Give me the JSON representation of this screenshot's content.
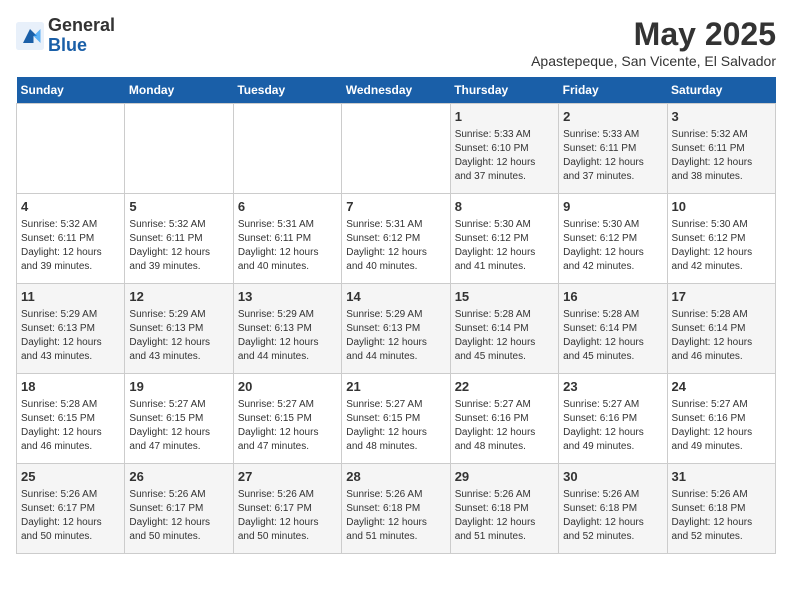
{
  "header": {
    "logo_general": "General",
    "logo_blue": "Blue",
    "month_year": "May 2025",
    "location": "Apastepeque, San Vicente, El Salvador"
  },
  "weekdays": [
    "Sunday",
    "Monday",
    "Tuesday",
    "Wednesday",
    "Thursday",
    "Friday",
    "Saturday"
  ],
  "weeks": [
    [
      {
        "day": "",
        "info": ""
      },
      {
        "day": "",
        "info": ""
      },
      {
        "day": "",
        "info": ""
      },
      {
        "day": "",
        "info": ""
      },
      {
        "day": "1",
        "info": "Sunrise: 5:33 AM\nSunset: 6:10 PM\nDaylight: 12 hours\nand 37 minutes."
      },
      {
        "day": "2",
        "info": "Sunrise: 5:33 AM\nSunset: 6:11 PM\nDaylight: 12 hours\nand 37 minutes."
      },
      {
        "day": "3",
        "info": "Sunrise: 5:32 AM\nSunset: 6:11 PM\nDaylight: 12 hours\nand 38 minutes."
      }
    ],
    [
      {
        "day": "4",
        "info": "Sunrise: 5:32 AM\nSunset: 6:11 PM\nDaylight: 12 hours\nand 39 minutes."
      },
      {
        "day": "5",
        "info": "Sunrise: 5:32 AM\nSunset: 6:11 PM\nDaylight: 12 hours\nand 39 minutes."
      },
      {
        "day": "6",
        "info": "Sunrise: 5:31 AM\nSunset: 6:11 PM\nDaylight: 12 hours\nand 40 minutes."
      },
      {
        "day": "7",
        "info": "Sunrise: 5:31 AM\nSunset: 6:12 PM\nDaylight: 12 hours\nand 40 minutes."
      },
      {
        "day": "8",
        "info": "Sunrise: 5:30 AM\nSunset: 6:12 PM\nDaylight: 12 hours\nand 41 minutes."
      },
      {
        "day": "9",
        "info": "Sunrise: 5:30 AM\nSunset: 6:12 PM\nDaylight: 12 hours\nand 42 minutes."
      },
      {
        "day": "10",
        "info": "Sunrise: 5:30 AM\nSunset: 6:12 PM\nDaylight: 12 hours\nand 42 minutes."
      }
    ],
    [
      {
        "day": "11",
        "info": "Sunrise: 5:29 AM\nSunset: 6:13 PM\nDaylight: 12 hours\nand 43 minutes."
      },
      {
        "day": "12",
        "info": "Sunrise: 5:29 AM\nSunset: 6:13 PM\nDaylight: 12 hours\nand 43 minutes."
      },
      {
        "day": "13",
        "info": "Sunrise: 5:29 AM\nSunset: 6:13 PM\nDaylight: 12 hours\nand 44 minutes."
      },
      {
        "day": "14",
        "info": "Sunrise: 5:29 AM\nSunset: 6:13 PM\nDaylight: 12 hours\nand 44 minutes."
      },
      {
        "day": "15",
        "info": "Sunrise: 5:28 AM\nSunset: 6:14 PM\nDaylight: 12 hours\nand 45 minutes."
      },
      {
        "day": "16",
        "info": "Sunrise: 5:28 AM\nSunset: 6:14 PM\nDaylight: 12 hours\nand 45 minutes."
      },
      {
        "day": "17",
        "info": "Sunrise: 5:28 AM\nSunset: 6:14 PM\nDaylight: 12 hours\nand 46 minutes."
      }
    ],
    [
      {
        "day": "18",
        "info": "Sunrise: 5:28 AM\nSunset: 6:15 PM\nDaylight: 12 hours\nand 46 minutes."
      },
      {
        "day": "19",
        "info": "Sunrise: 5:27 AM\nSunset: 6:15 PM\nDaylight: 12 hours\nand 47 minutes."
      },
      {
        "day": "20",
        "info": "Sunrise: 5:27 AM\nSunset: 6:15 PM\nDaylight: 12 hours\nand 47 minutes."
      },
      {
        "day": "21",
        "info": "Sunrise: 5:27 AM\nSunset: 6:15 PM\nDaylight: 12 hours\nand 48 minutes."
      },
      {
        "day": "22",
        "info": "Sunrise: 5:27 AM\nSunset: 6:16 PM\nDaylight: 12 hours\nand 48 minutes."
      },
      {
        "day": "23",
        "info": "Sunrise: 5:27 AM\nSunset: 6:16 PM\nDaylight: 12 hours\nand 49 minutes."
      },
      {
        "day": "24",
        "info": "Sunrise: 5:27 AM\nSunset: 6:16 PM\nDaylight: 12 hours\nand 49 minutes."
      }
    ],
    [
      {
        "day": "25",
        "info": "Sunrise: 5:26 AM\nSunset: 6:17 PM\nDaylight: 12 hours\nand 50 minutes."
      },
      {
        "day": "26",
        "info": "Sunrise: 5:26 AM\nSunset: 6:17 PM\nDaylight: 12 hours\nand 50 minutes."
      },
      {
        "day": "27",
        "info": "Sunrise: 5:26 AM\nSunset: 6:17 PM\nDaylight: 12 hours\nand 50 minutes."
      },
      {
        "day": "28",
        "info": "Sunrise: 5:26 AM\nSunset: 6:18 PM\nDaylight: 12 hours\nand 51 minutes."
      },
      {
        "day": "29",
        "info": "Sunrise: 5:26 AM\nSunset: 6:18 PM\nDaylight: 12 hours\nand 51 minutes."
      },
      {
        "day": "30",
        "info": "Sunrise: 5:26 AM\nSunset: 6:18 PM\nDaylight: 12 hours\nand 52 minutes."
      },
      {
        "day": "31",
        "info": "Sunrise: 5:26 AM\nSunset: 6:18 PM\nDaylight: 12 hours\nand 52 minutes."
      }
    ]
  ]
}
